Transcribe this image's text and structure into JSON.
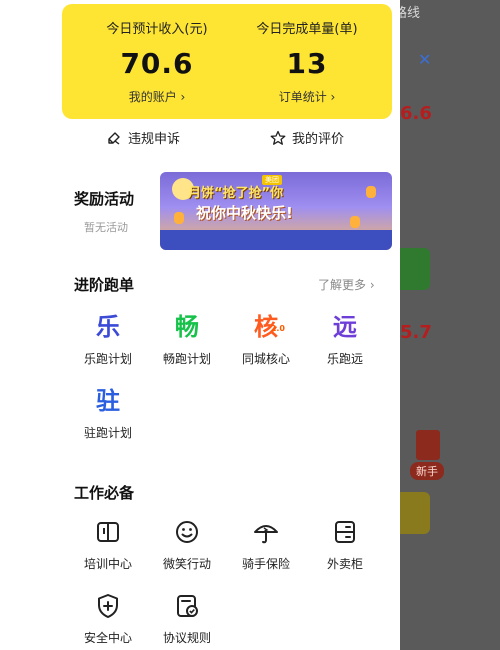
{
  "background": {
    "route_label": "路线",
    "value_top": "6.6",
    "value_mid": "5.7",
    "newbie_badge": "新手"
  },
  "earnings": {
    "income_label": "今日预计收入(元)",
    "income_value": "70.6",
    "account_link": "我的账户 ›",
    "orders_label": "今日完成单量(单)",
    "orders_value": "13",
    "orders_link": "订单统计 ›"
  },
  "quick": {
    "appeal": "违规申诉",
    "reviews": "我的评价"
  },
  "reward": {
    "title": "奖励活动",
    "empty": "暂无活动",
    "banner_line1": "月饼“抢了抢”你",
    "banner_line2": "祝你中秋快乐!",
    "banner_brand": "美团"
  },
  "advanced": {
    "title": "进阶跑单",
    "more": "了解更多 ›",
    "plans": [
      {
        "glyph": "乐",
        "label": "乐跑计划",
        "color": "#3c4bd6"
      },
      {
        "glyph": "畅",
        "label": "畅跑计划",
        "color": "#17c24a"
      },
      {
        "glyph": "核",
        "label": "同城核心",
        "color": "#ff5a1f",
        "sub": "2.0"
      },
      {
        "glyph": "远",
        "label": "乐跑远",
        "color": "#6e3fd8"
      },
      {
        "glyph": "驻",
        "label": "驻跑计划",
        "color": "#2b5fe0"
      }
    ]
  },
  "tools": {
    "title": "工作必备",
    "items": [
      {
        "label": "培训中心",
        "icon": "book-icon"
      },
      {
        "label": "微笑行动",
        "icon": "smile-icon"
      },
      {
        "label": "骑手保险",
        "icon": "umbrella-icon"
      },
      {
        "label": "外卖柜",
        "icon": "locker-icon"
      },
      {
        "label": "安全中心",
        "icon": "shield-icon"
      },
      {
        "label": "协议规则",
        "icon": "document-check-icon"
      }
    ]
  }
}
